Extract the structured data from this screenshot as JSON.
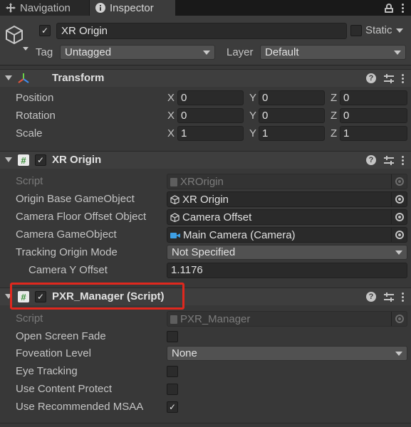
{
  "tabs": [
    {
      "label": "Navigation",
      "icon": "navigation-icon"
    },
    {
      "label": "Inspector",
      "icon": "info-icon"
    }
  ],
  "header": {
    "object_name": "XR Origin",
    "active": true,
    "static_label": "Static",
    "tag_label": "Tag",
    "tag_value": "Untagged",
    "layer_label": "Layer",
    "layer_value": "Default"
  },
  "transform": {
    "title": "Transform",
    "rows": [
      {
        "label": "Position",
        "x": "0",
        "y": "0",
        "z": "0"
      },
      {
        "label": "Rotation",
        "x": "0",
        "y": "0",
        "z": "0"
      },
      {
        "label": "Scale",
        "x": "1",
        "y": "1",
        "z": "1"
      }
    ],
    "axis_labels": [
      "X",
      "Y",
      "Z"
    ]
  },
  "xr_origin": {
    "title": "XR Origin",
    "enabled": true,
    "script_label": "Script",
    "script_value": "XROrigin",
    "origin_base_label": "Origin Base GameObject",
    "origin_base_value": "XR Origin",
    "camera_floor_label": "Camera Floor Offset Object",
    "camera_floor_value": "Camera Offset",
    "camera_go_label": "Camera GameObject",
    "camera_go_value": "Main Camera (Camera)",
    "tracking_mode_label": "Tracking Origin Mode",
    "tracking_mode_value": "Not Specified",
    "camera_y_label": "Camera Y Offset",
    "camera_y_value": "1.1176"
  },
  "pxr_manager": {
    "title": "PXR_Manager (Script)",
    "enabled": true,
    "script_label": "Script",
    "script_value": "PXR_Manager",
    "open_screen_fade_label": "Open Screen Fade",
    "open_screen_fade": false,
    "foveation_label": "Foveation Level",
    "foveation_value": "None",
    "eye_tracking_label": "Eye Tracking",
    "eye_tracking": false,
    "content_protect_label": "Use Content Protect",
    "content_protect": false,
    "msaa_label": "Use Recommended MSAA",
    "msaa": true
  },
  "colors": {
    "highlight": "#e0281e",
    "script_green": "#3a8f3a",
    "camera_blue": "#3ea0e6"
  }
}
